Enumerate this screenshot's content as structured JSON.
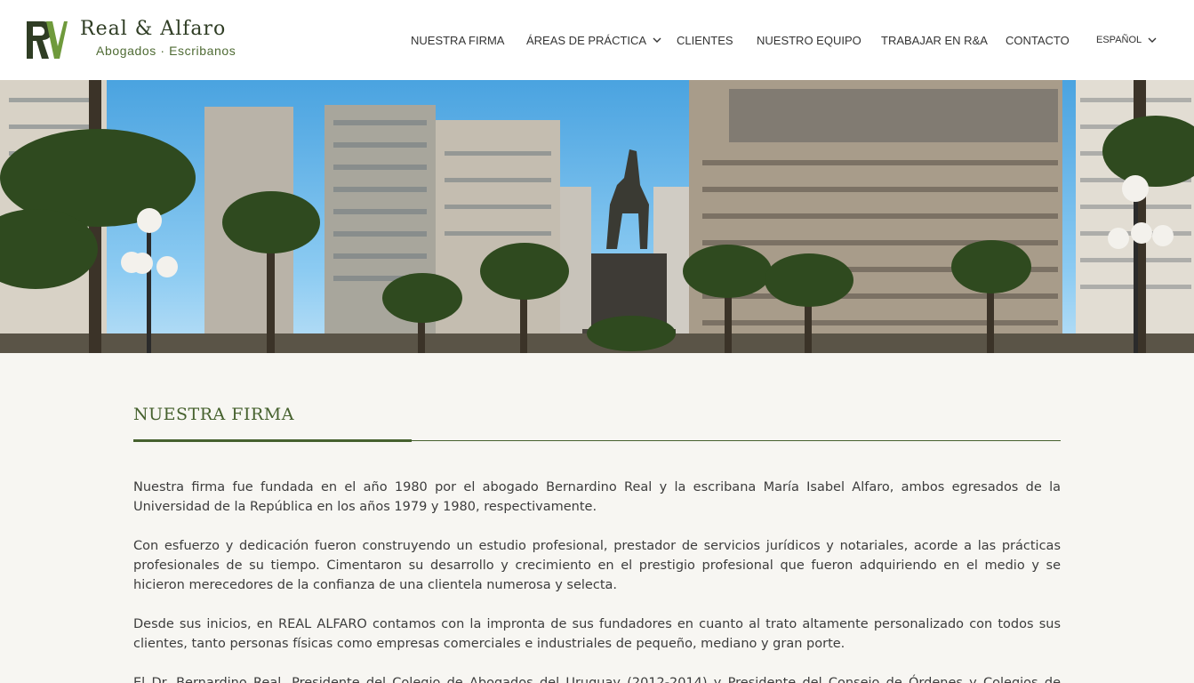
{
  "brand": {
    "title": "Real & Alfaro",
    "subtitle": "Abogados · Escribanos"
  },
  "nav": {
    "items": [
      {
        "label": "NUESTRA FIRMA"
      },
      {
        "label": "ÁREAS DE PRÁCTICA"
      },
      {
        "label": "CLIENTES"
      },
      {
        "label": "NUESTRO EQUIPO"
      },
      {
        "label": "TRABAJAR EN R&A"
      },
      {
        "label": "CONTACTO"
      }
    ],
    "language": "ESPAÑOL"
  },
  "section": {
    "title": "NUESTRA FIRMA",
    "paragraphs": [
      "Nuestra firma fue fundada en el año 1980 por el abogado Bernardino Real y la escribana María Isabel Alfaro, ambos egresados de la Universidad de la República en los años 1979 y 1980, respectivamente.",
      "Con esfuerzo y dedicación fueron construyendo un estudio profesional, prestador de servicios jurídicos y notariales, acorde a las prácticas profesionales de su tiempo. Cimentaron su desarrollo y crecimiento en el prestigio profesional que fueron adquiriendo en el medio y se hicieron merecedores de la confianza de una clientela numerosa y selecta.",
      "Desde sus inicios, en REAL ALFARO contamos con la impronta de sus fundadores en cuanto al trato altamente personalizado con todos sus clientes, tanto personas físicas como empresas comerciales e industriales de pequeño, mediano y gran porte.",
      "El Dr. Bernardino Real, Presidente del Colegio de Abogados del Uruguay (2012-2014) y Presidente del Consejo de Órdenes y Colegios de Abogados"
    ]
  },
  "colors": {
    "brand_green": "#46612e",
    "logo_green": "#2f3d24",
    "background": "#f7f6f2"
  },
  "icons": {
    "dropdown": "chevron-down-icon"
  }
}
